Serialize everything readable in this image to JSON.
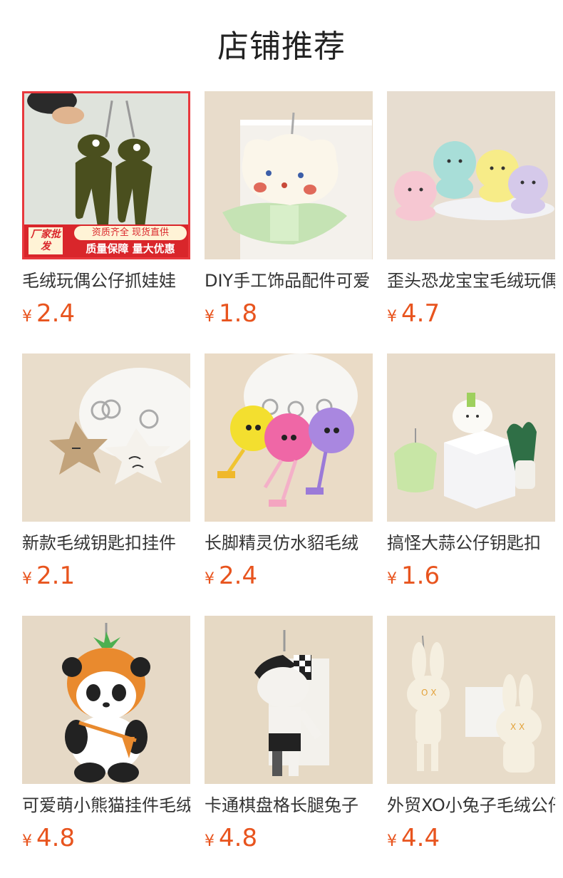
{
  "page": {
    "title": "店铺推荐"
  },
  "banner": {
    "left": "厂家批发",
    "top": "资质齐全 现货直供",
    "bottom": "质量保障 量大优惠"
  },
  "currency": "¥",
  "products": [
    {
      "name": "毛绒玩偶公仔抓娃娃",
      "price": "2.4",
      "image": "frog-plush-keychain"
    },
    {
      "name": "DIY手工饰品配件可爱",
      "price": "1.8",
      "image": "cloud-flower-plush"
    },
    {
      "name": "歪头恐龙宝宝毛绒玩偶",
      "price": "4.7",
      "image": "baby-dinosaur-plush"
    },
    {
      "name": "新款毛绒钥匙扣挂件",
      "price": "2.1",
      "image": "star-plush-keychain"
    },
    {
      "name": "长脚精灵仿水貂毛绒",
      "price": "2.4",
      "image": "furball-sprite-keychain"
    },
    {
      "name": "搞怪大蒜公仔钥匙扣",
      "price": "1.6",
      "image": "vegetable-plush-keychain"
    },
    {
      "name": "可爱萌小熊猫挂件毛绒",
      "price": "4.8",
      "image": "panda-carrot-plush"
    },
    {
      "name": "卡通棋盘格长腿兔子",
      "price": "4.8",
      "image": "checkered-rabbit-plush"
    },
    {
      "name": "外贸XO小兔子毛绒公仔",
      "price": "4.4",
      "image": "xo-rabbit-plush"
    }
  ]
}
